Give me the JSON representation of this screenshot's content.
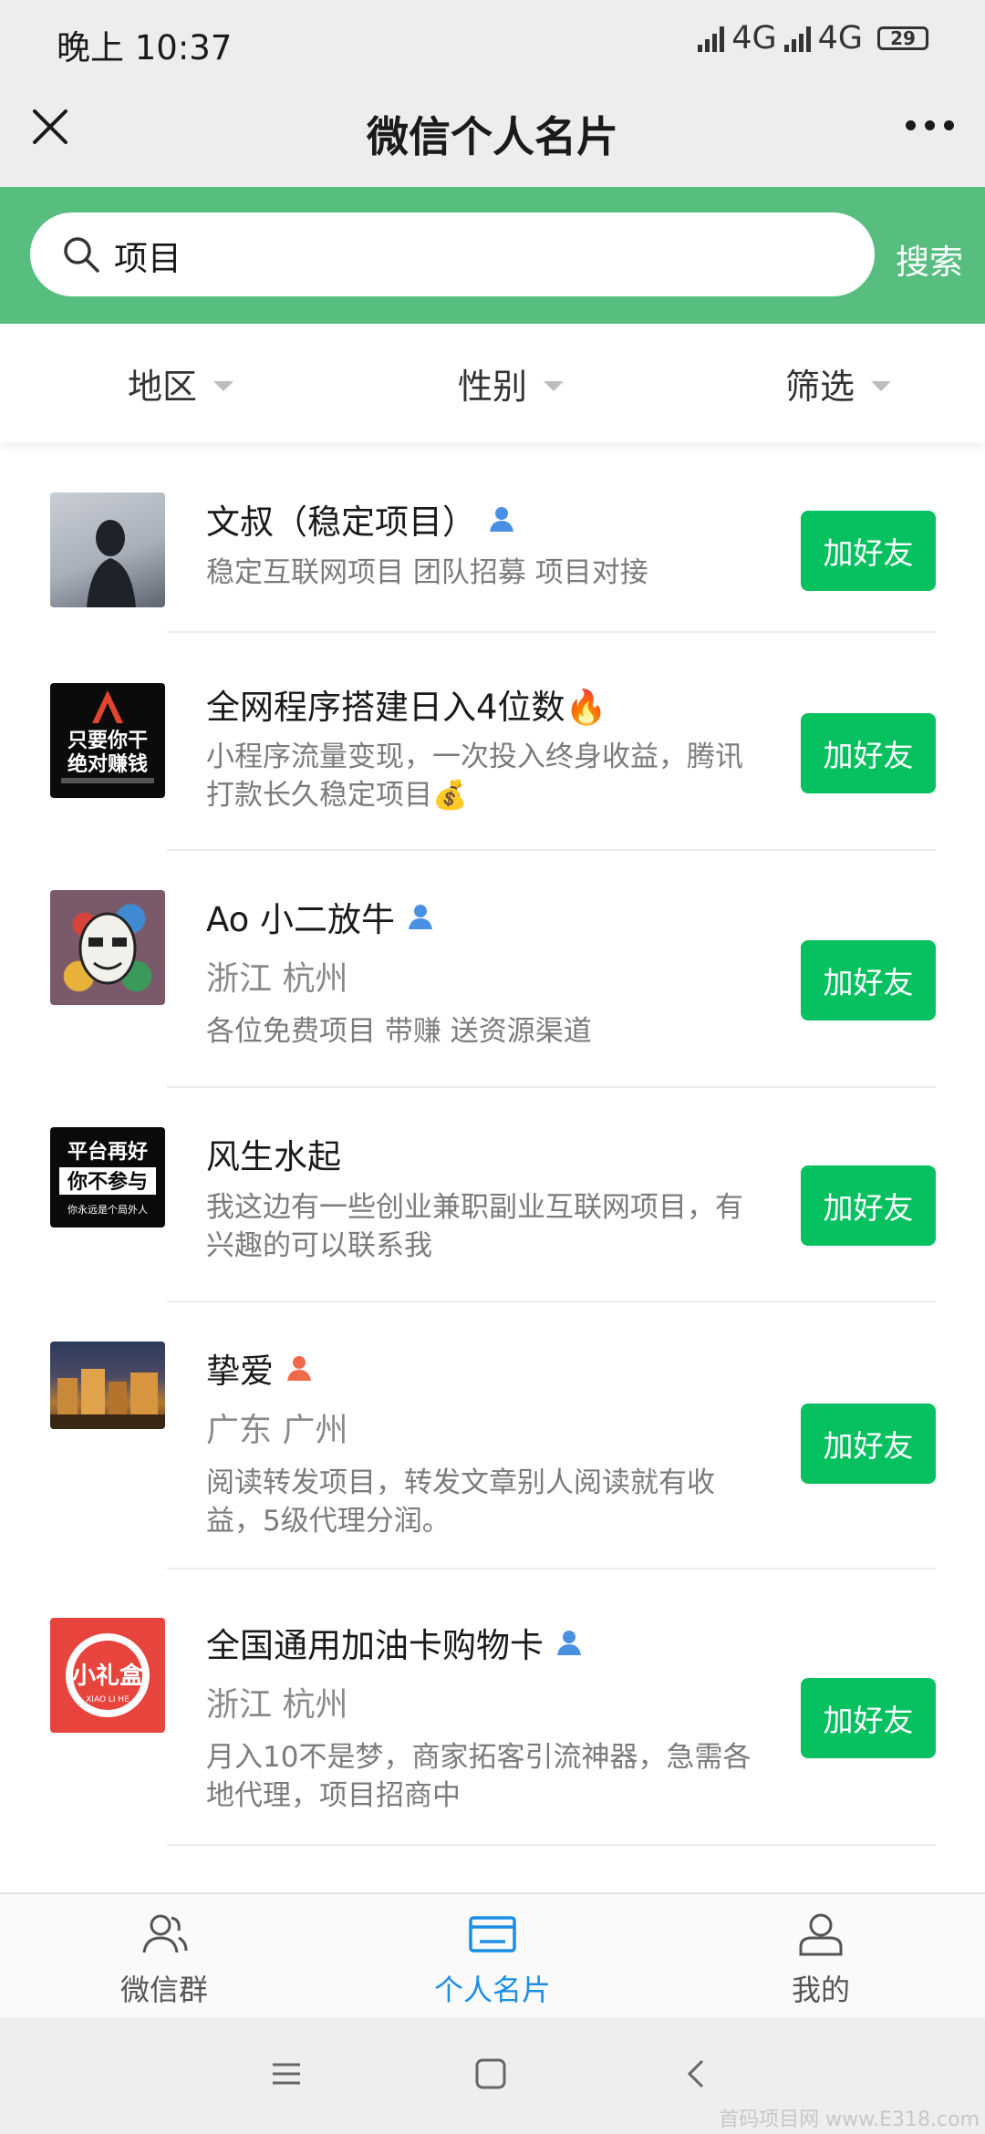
{
  "status_bar": {
    "time": "晚上 10:37",
    "network1": "4G",
    "network2": "4G",
    "battery": "29"
  },
  "header": {
    "title": "微信个人名片"
  },
  "search": {
    "value": "项目",
    "button_label": "搜索"
  },
  "filters": {
    "region": "地区",
    "gender": "性别",
    "filter": "筛选"
  },
  "cards": [
    {
      "name": "文叔（稳定项目）",
      "gender_icon": "male",
      "location": "",
      "desc": "稳定互联网项目 团队招募 项目对接",
      "button": "加好友"
    },
    {
      "name": "全网程序搭建日入4位数🔥",
      "gender_icon": "",
      "location": "",
      "desc": "小程序流量变现，一次投入终身收益，腾讯打款长久稳定项目💰",
      "button": "加好友"
    },
    {
      "name": "Ao 小二放牛",
      "gender_icon": "male",
      "location": "浙江 杭州",
      "desc": "各位免费项目 带赚 送资源渠道",
      "button": "加好友"
    },
    {
      "name": "风生水起",
      "gender_icon": "",
      "location": "",
      "desc": "我这边有一些创业兼职副业互联网项目，有兴趣的可以联系我",
      "button": "加好友"
    },
    {
      "name": "挚爱",
      "gender_icon": "female",
      "location": "广东 广州",
      "desc": "阅读转发项目，转发文章别人阅读就有收益，5级代理分润。",
      "button": "加好友"
    },
    {
      "name": "全国通用加油卡购物卡",
      "gender_icon": "male",
      "location": "浙江 杭州",
      "desc": "月入10不是梦，商家拓客引流神器，急需各地代理，项目招商中",
      "button": "加好友"
    }
  ],
  "avatar_texts": {
    "a2_line1": "只要你干",
    "a2_line2": "绝对赚钱",
    "a4_line1": "平台再好",
    "a4_line2": "你不参与",
    "a4_line3": "你永远是个局外人",
    "a6_text": "小礼盒",
    "a6_sub": "XIAO LI HE"
  },
  "tabs": {
    "groups": "微信群",
    "cards": "个人名片",
    "mine": "我的"
  },
  "colors": {
    "brand_green": "#57be80",
    "button_green": "#07c160",
    "active_tab": "#1a8fe8",
    "male_icon": "#4a90e2",
    "female_icon": "#f06a4a"
  },
  "watermark": "首码项目网 www.E318.com"
}
